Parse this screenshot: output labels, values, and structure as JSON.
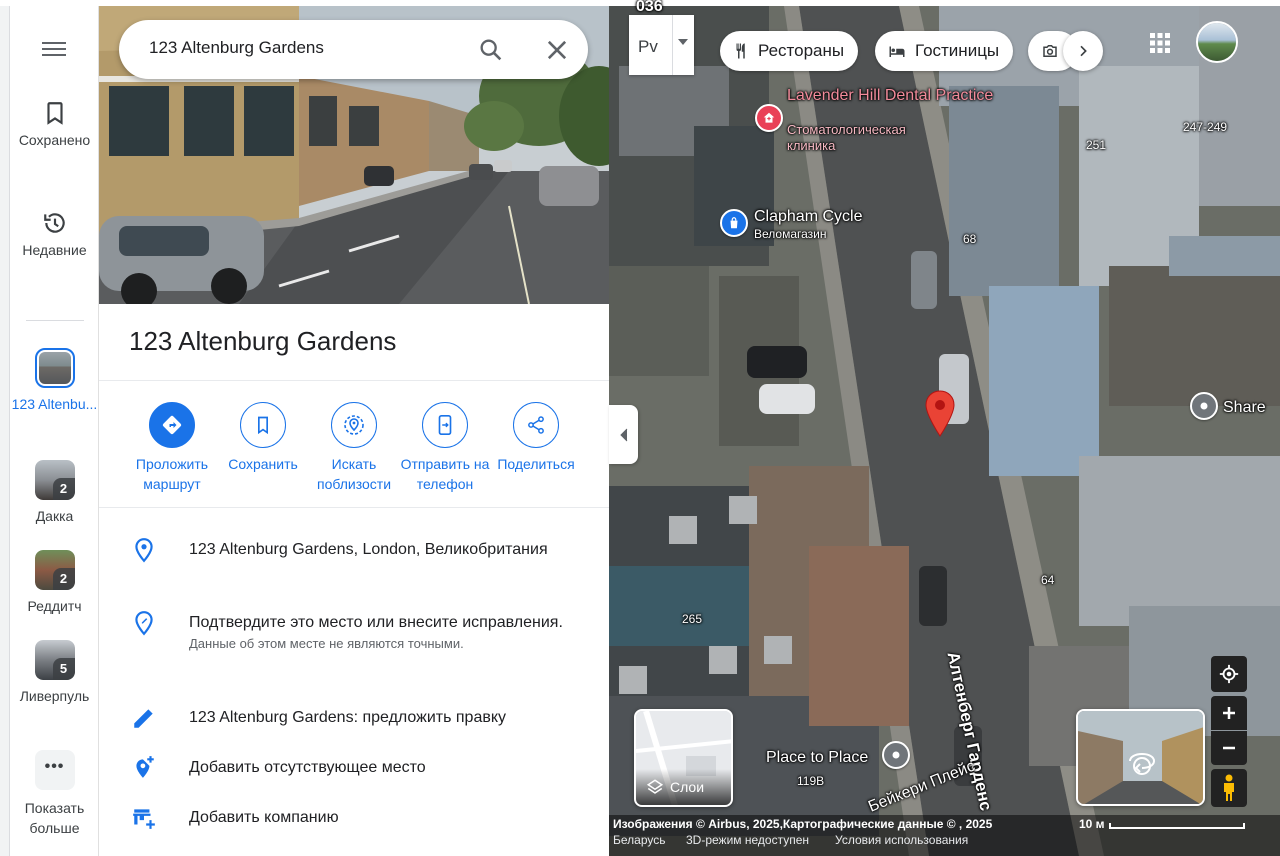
{
  "rail": {
    "saved": "Сохранено",
    "recent": "Недавние",
    "recent_places": [
      {
        "label": "123 Altenbu...",
        "count": "",
        "active": true
      },
      {
        "label": "Дакка",
        "count": "2"
      },
      {
        "label": "Реддитч",
        "count": "2"
      },
      {
        "label": "Ливерпуль",
        "count": "5"
      }
    ],
    "more_dots": "•••",
    "more": "Показать больше"
  },
  "search": {
    "value": "123 Altenburg Gardens"
  },
  "place": {
    "title": "123 Altenburg Gardens",
    "actions": [
      {
        "label": "Проложить маршрут",
        "icon": "directions-icon"
      },
      {
        "label": "Сохранить",
        "icon": "bookmark-icon"
      },
      {
        "label": "Искать поблизости",
        "icon": "nearby-icon"
      },
      {
        "label": "Отправить на телефон",
        "icon": "send-to-phone-icon"
      },
      {
        "label": "Поделиться",
        "icon": "share-icon"
      }
    ],
    "address": "123 Altenburg Gardens, London, Великобритания",
    "confirm": "Подтвердите это место или внесите исправления.",
    "confirm_note": "Данные об этом месте не являются точными.",
    "suggest_edit": "123 Altenburg Gardens: предложить правку",
    "add_missing": "Добавить отсутствующее место",
    "add_business": "Добавить компанию"
  },
  "map": {
    "lang_code": "Рv",
    "chips": [
      "Рестораны",
      "Гостиницы"
    ],
    "top_label": "036",
    "labels": {
      "dental_en": "Lavender Hill Dental Practice",
      "dental_ru": "Стоматологическая клиника",
      "cycle_en": "Clapham Cycle",
      "cycle_ru": "Веломагазин",
      "share": "Share",
      "place_to_place": "Place to Place",
      "street": "Алтенберг Гарденс",
      "baker": "Бейкери Плейс",
      "num_247": "247-249",
      "num_251": "251",
      "num_68": "68",
      "num_64": "64",
      "num_265": "265",
      "num_119b": "119B"
    },
    "layers_label": "Слои",
    "attribution": "Изображения © Airbus, 2025,Картографические данные © , 2025",
    "scale": "10 м",
    "footer_links": [
      "Беларусь",
      "3D-режим недоступен",
      "Условия использования"
    ]
  },
  "colors": {
    "accent": "#1a73e8",
    "pin": "#ea4335",
    "cycle_poi": "#1a73e8",
    "dental_poi": "#e94057"
  }
}
